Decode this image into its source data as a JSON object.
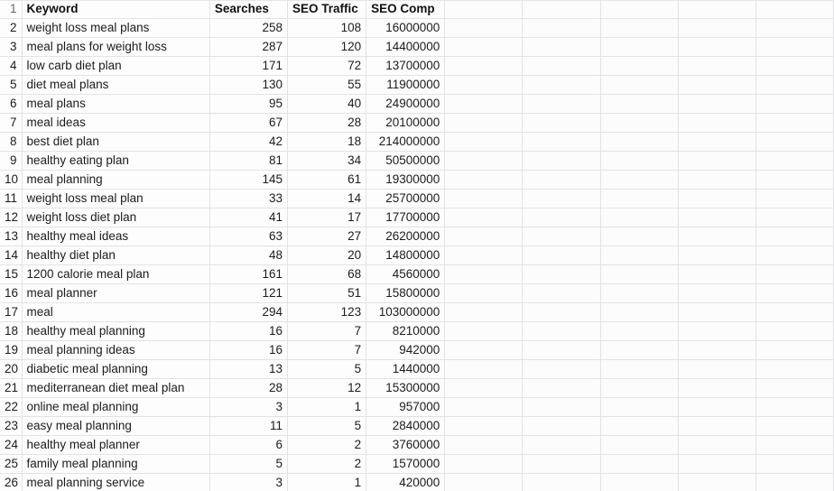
{
  "sheet": {
    "columns": [
      {
        "key": "keyword",
        "header": "Keyword",
        "align": "left"
      },
      {
        "key": "searches",
        "header": "Searches",
        "align": "right"
      },
      {
        "key": "traffic",
        "header": "SEO Traffic",
        "align": "right"
      },
      {
        "key": "comp",
        "header": "SEO Comp",
        "align": "right"
      }
    ],
    "empty_column_count": 5,
    "first_row_number": 1,
    "header_row_number": 1,
    "row_numbers": [
      1,
      2,
      3,
      4,
      5,
      6,
      7,
      8,
      9,
      10,
      11,
      12,
      13,
      14,
      15,
      16,
      17,
      18,
      19,
      20,
      21,
      22,
      23,
      24,
      25,
      26
    ],
    "rows": [
      {
        "n": "2",
        "keyword": "weight loss meal plans",
        "searches": "258",
        "traffic": "108",
        "comp": "16000000"
      },
      {
        "n": "3",
        "keyword": "meal plans for weight loss",
        "searches": "287",
        "traffic": "120",
        "comp": "14400000"
      },
      {
        "n": "4",
        "keyword": "low carb diet plan",
        "searches": "171",
        "traffic": "72",
        "comp": "13700000"
      },
      {
        "n": "5",
        "keyword": "diet meal plans",
        "searches": "130",
        "traffic": "55",
        "comp": "11900000"
      },
      {
        "n": "6",
        "keyword": "meal plans",
        "searches": "95",
        "traffic": "40",
        "comp": "24900000"
      },
      {
        "n": "7",
        "keyword": "meal ideas",
        "searches": "67",
        "traffic": "28",
        "comp": "20100000"
      },
      {
        "n": "8",
        "keyword": "best diet plan",
        "searches": "42",
        "traffic": "18",
        "comp": "214000000"
      },
      {
        "n": "9",
        "keyword": "healthy eating plan",
        "searches": "81",
        "traffic": "34",
        "comp": "50500000"
      },
      {
        "n": "10",
        "keyword": "meal planning",
        "searches": "145",
        "traffic": "61",
        "comp": "19300000"
      },
      {
        "n": "11",
        "keyword": "weight loss meal plan",
        "searches": "33",
        "traffic": "14",
        "comp": "25700000"
      },
      {
        "n": "12",
        "keyword": "weight loss diet plan",
        "searches": "41",
        "traffic": "17",
        "comp": "17700000"
      },
      {
        "n": "13",
        "keyword": "healthy meal ideas",
        "searches": "63",
        "traffic": "27",
        "comp": "26200000"
      },
      {
        "n": "14",
        "keyword": "healthy diet plan",
        "searches": "48",
        "traffic": "20",
        "comp": "14800000"
      },
      {
        "n": "15",
        "keyword": "1200 calorie meal plan",
        "searches": "161",
        "traffic": "68",
        "comp": "4560000"
      },
      {
        "n": "16",
        "keyword": "meal planner",
        "searches": "121",
        "traffic": "51",
        "comp": "15800000"
      },
      {
        "n": "17",
        "keyword": "meal",
        "searches": "294",
        "traffic": "123",
        "comp": "103000000"
      },
      {
        "n": "18",
        "keyword": "healthy meal planning",
        "searches": "16",
        "traffic": "7",
        "comp": "8210000"
      },
      {
        "n": "19",
        "keyword": "meal planning ideas",
        "searches": "16",
        "traffic": "7",
        "comp": "942000"
      },
      {
        "n": "20",
        "keyword": "diabetic meal planning",
        "searches": "13",
        "traffic": "5",
        "comp": "1440000"
      },
      {
        "n": "21",
        "keyword": "mediterranean diet meal plan",
        "searches": "28",
        "traffic": "12",
        "comp": "15300000"
      },
      {
        "n": "22",
        "keyword": "online meal planning",
        "searches": "3",
        "traffic": "1",
        "comp": "957000"
      },
      {
        "n": "23",
        "keyword": "easy meal planning",
        "searches": "11",
        "traffic": "5",
        "comp": "2840000"
      },
      {
        "n": "24",
        "keyword": "healthy meal planner",
        "searches": "6",
        "traffic": "2",
        "comp": "3760000"
      },
      {
        "n": "25",
        "keyword": "family meal planning",
        "searches": "5",
        "traffic": "2",
        "comp": "1570000"
      },
      {
        "n": "26",
        "keyword": "meal planning service",
        "searches": "3",
        "traffic": "1",
        "comp": "420000"
      }
    ]
  },
  "colors": {
    "grid_line": "#e3e3e5",
    "gutter_text": "#63666b",
    "cell_text": "#1c1c1e",
    "background": "#fdfdfd"
  }
}
